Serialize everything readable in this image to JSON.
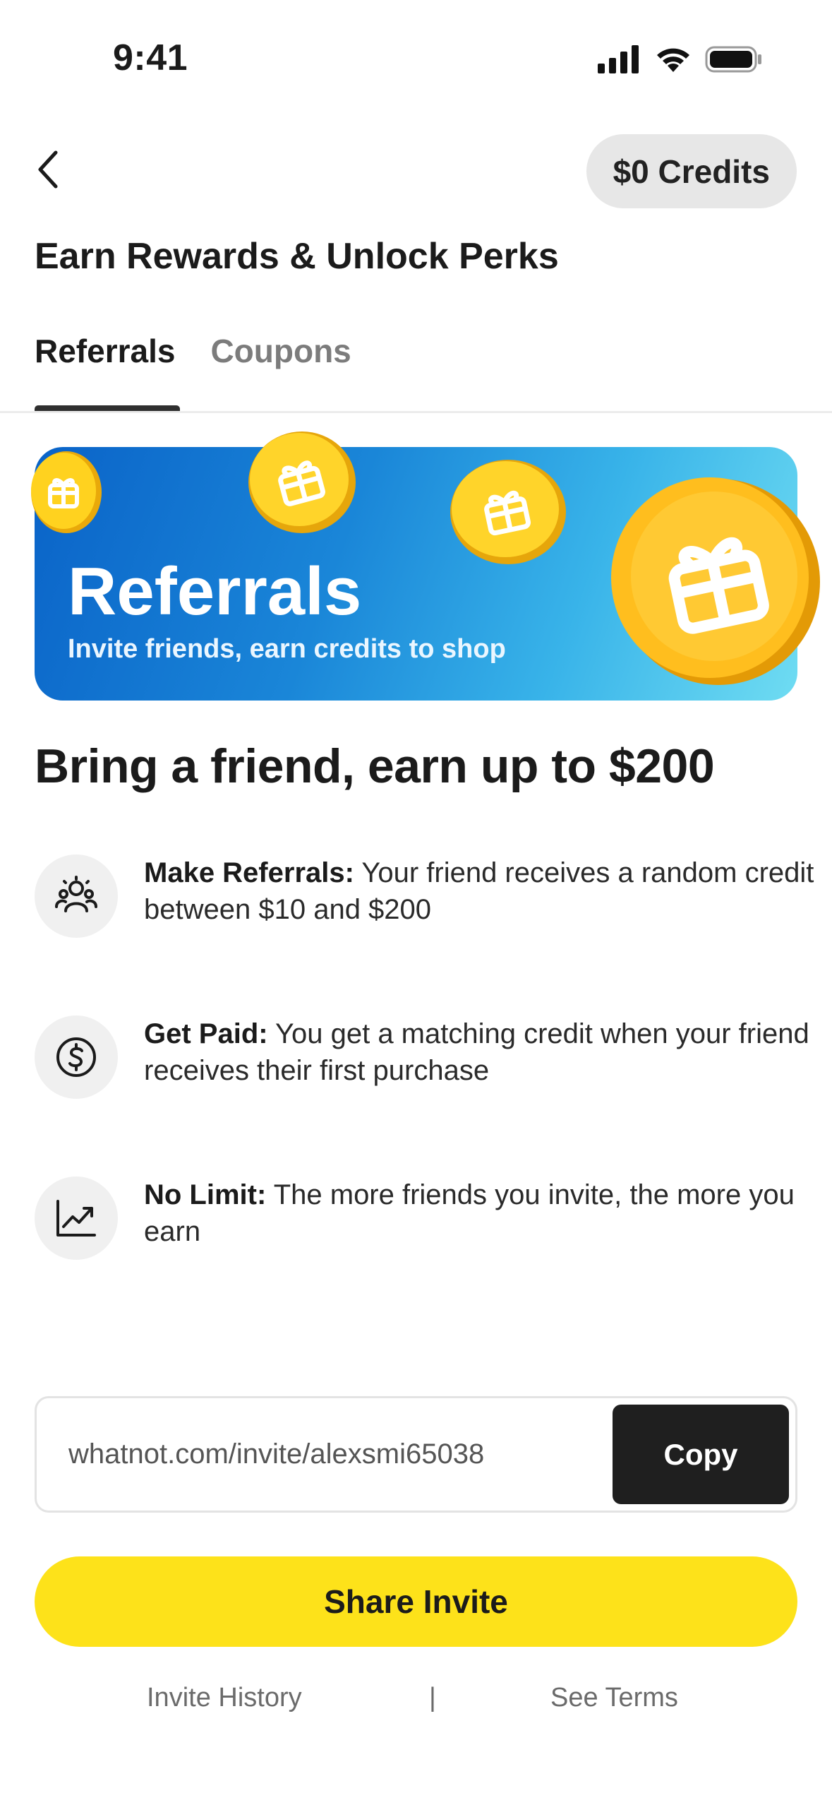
{
  "status_bar": {
    "time": "9:41"
  },
  "header": {
    "credits_label": "$0 Credits",
    "title": "Earn Rewards & Unlock Perks"
  },
  "tabs": [
    {
      "label": "Referrals",
      "active": true
    },
    {
      "label": "Coupons",
      "active": false
    }
  ],
  "hero": {
    "title": "Referrals",
    "subtitle": "Invite friends, earn credits to shop"
  },
  "main": {
    "heading": "Bring a friend, earn up to $200",
    "features": [
      {
        "icon": "people-icon",
        "title": "Make Referrals:",
        "body": " Your friend receives a random credit between $10 and $200"
      },
      {
        "icon": "dollar-circle-icon",
        "title": "Get Paid:",
        "body": " You get a matching credit when your friend receives their first purchase"
      },
      {
        "icon": "trending-up-icon",
        "title": "No Limit:",
        "body": " The more friends you invite, the more you earn"
      }
    ]
  },
  "invite": {
    "link": "whatnot.com/invite/alexsmi65038",
    "copy_label": "Copy",
    "share_label": "Share Invite"
  },
  "footer": {
    "history_label": "Invite History",
    "separator": "|",
    "terms_label": "See Terms"
  },
  "colors": {
    "accent_yellow": "#fde21a",
    "banner_blue": "#1a86d8",
    "dark": "#1f1f1f"
  }
}
